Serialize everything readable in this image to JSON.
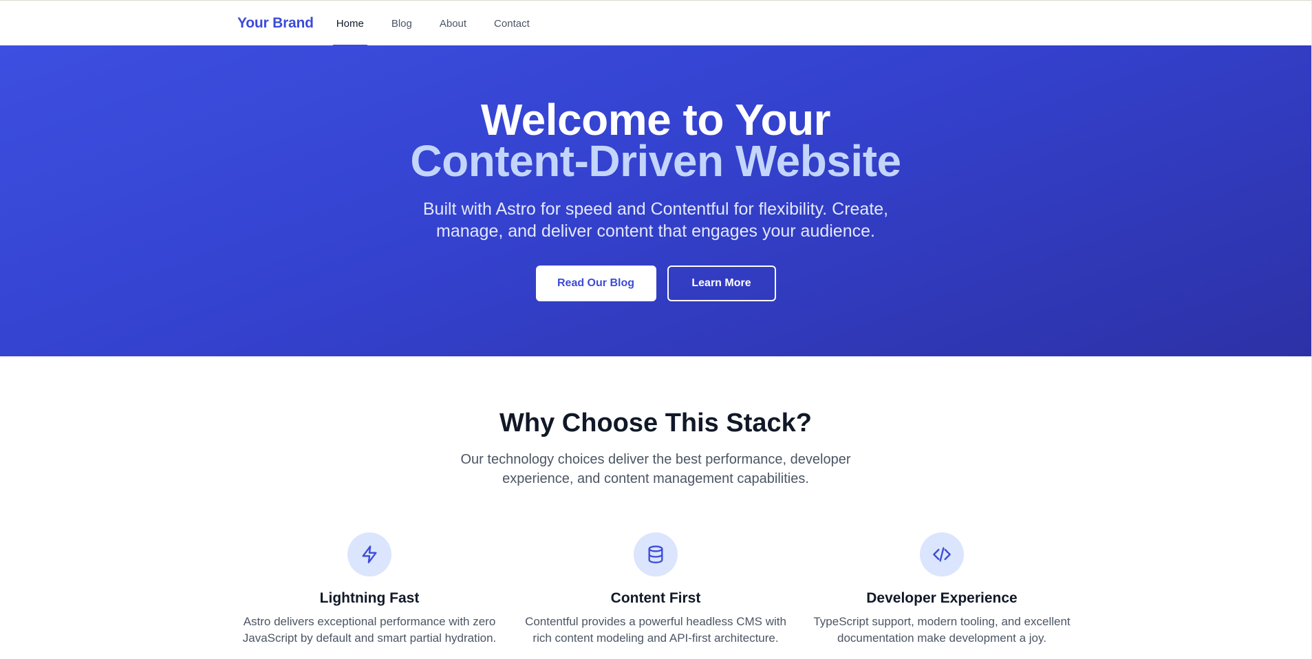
{
  "header": {
    "brand": "Your Brand",
    "nav": [
      {
        "label": "Home",
        "active": true
      },
      {
        "label": "Blog",
        "active": false
      },
      {
        "label": "About",
        "active": false
      },
      {
        "label": "Contact",
        "active": false
      }
    ]
  },
  "hero": {
    "title_line1": "Welcome to Your",
    "title_line2": "Content-Driven Website",
    "subtitle": "Built with Astro for speed and Contentful for flexibility. Create, manage, and deliver content that engages your audience.",
    "primary_button": "Read Our Blog",
    "secondary_button": "Learn More"
  },
  "features": {
    "title": "Why Choose This Stack?",
    "subtitle": "Our technology choices deliver the best performance, developer experience, and content management capabilities.",
    "items": [
      {
        "icon": "lightning-icon",
        "title": "Lightning Fast",
        "description": "Astro delivers exceptional performance with zero JavaScript by default and smart partial hydration."
      },
      {
        "icon": "database-icon",
        "title": "Content First",
        "description": "Contentful provides a powerful headless CMS with rich content modeling and API-first architecture."
      },
      {
        "icon": "code-icon",
        "title": "Developer Experience",
        "description": "TypeScript support, modern tooling, and excellent documentation make development a joy."
      }
    ]
  },
  "colors": {
    "accent": "#3b4bd8",
    "hero_gradient_start": "#3d4fe0",
    "hero_gradient_end": "#2d31a6",
    "hero_title_highlight": "#c3d5fb",
    "icon_bg": "#dbe5fd"
  }
}
